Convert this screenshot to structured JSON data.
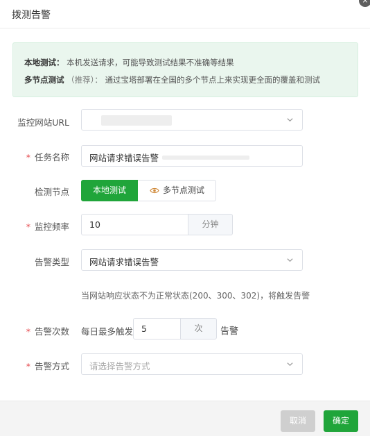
{
  "dialog": {
    "title": "拨测告警",
    "close_glyph": "×"
  },
  "notice": {
    "local_title": "本地测试：",
    "local_text": "本机发送请求，可能导致测试结果不准确等结果",
    "multi_title": "多节点测试",
    "multi_paren": "（推荐）：",
    "multi_text": "通过宝塔部署在全国的多个节点上来实现更全面的覆盖和测试"
  },
  "form": {
    "url": {
      "label": "监控网站URL",
      "value": ""
    },
    "task_name": {
      "label": "任务名称",
      "required": "*",
      "value": "网站请求错误告警"
    },
    "detect_node": {
      "label": "检测节点",
      "option_local": "本地测试",
      "option_multi": "多节点测试",
      "selected": "本地测试"
    },
    "frequency": {
      "label": "监控频率",
      "required": "*",
      "value": "10",
      "unit": "分钟"
    },
    "alert_type": {
      "label": "告警类型",
      "value": "网站请求错误告警"
    },
    "hint": "当网站响应状态不为正常状态(200、300、302)，将触发告警",
    "alert_count": {
      "label": "告警次数",
      "required": "*",
      "prefix": "每日最多触发",
      "value": "5",
      "unit": "次",
      "suffix": "告警"
    },
    "alert_method": {
      "label": "告警方式",
      "required": "*",
      "placeholder": "请选择告警方式"
    }
  },
  "footer": {
    "cancel_label": "取消",
    "ok_label": "确定"
  },
  "colors": {
    "accent": "#20a53a",
    "notice_bg": "#eaf6ee",
    "required": "#e5484d"
  },
  "icons": {
    "close": "close-icon",
    "chevron": "chevron-down-icon",
    "eye": "eye-icon"
  }
}
